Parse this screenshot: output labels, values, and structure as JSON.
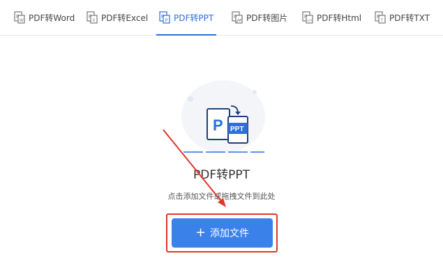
{
  "tabs": [
    {
      "label": "PDF转Word",
      "icon": "pdf-to-word-icon"
    },
    {
      "label": "PDF转Excel",
      "icon": "pdf-to-excel-icon"
    },
    {
      "label": "PDF转PPT",
      "icon": "pdf-to-ppt-icon",
      "active": true
    },
    {
      "label": "PDF转图片",
      "icon": "pdf-to-image-icon"
    },
    {
      "label": "PDF转Html",
      "icon": "pdf-to-html-icon"
    },
    {
      "label": "PDF转TXT",
      "icon": "pdf-to-txt-icon"
    }
  ],
  "main": {
    "illustration_icon": "pdf-to-ppt-illustration-icon",
    "illustration_left_letter": "P",
    "illustration_right_text": "PPT",
    "title": "PDF转PPT",
    "hint": "点击添加文件或拖拽文件到此处",
    "add_button_icon": "plus-icon",
    "add_button_label": "添加文件"
  },
  "colors": {
    "accent": "#2b6fe0",
    "button": "#3a82ea",
    "annotation": "#e0362b"
  }
}
